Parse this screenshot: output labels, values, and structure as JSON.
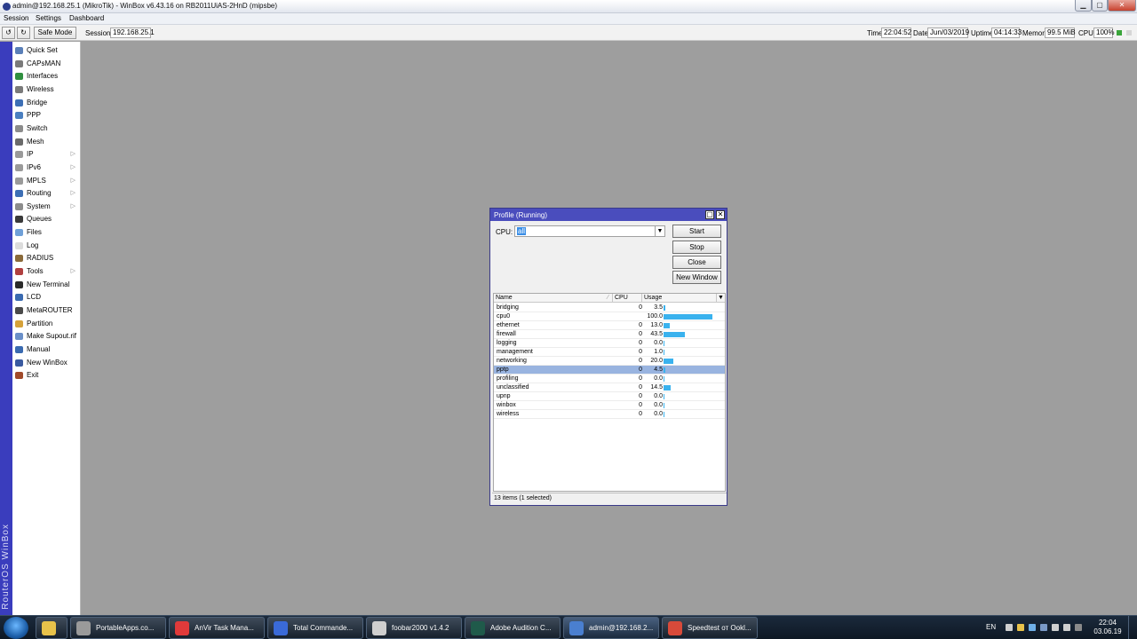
{
  "window": {
    "title": "admin@192.168.25.1 (MikroTik) - WinBox v6.43.16 on RB2011UiAS-2HnD (mipsbe)",
    "controls": {
      "minimize": "▁",
      "maximize": "▢",
      "close": "✕"
    }
  },
  "menu": [
    "Session",
    "Settings",
    "Dashboard"
  ],
  "toolbar": {
    "undo_icon": "↺",
    "redo_icon": "↻",
    "safe_mode": "Safe Mode",
    "session_label": "Session:",
    "session_value": "192.168.25.1",
    "time_label": "Time",
    "time_value": "22:04:52",
    "date_label": "Date",
    "date_value": "Jun/03/2019",
    "uptime_label": "Uptime",
    "uptime_value": "04:14:33",
    "memory_label": "Memory",
    "memory_value": "99.5 MiB",
    "cpu_label": "CPU",
    "cpu_value": "100%",
    "status_colors": [
      "#3aa53a",
      "#d6d6d6"
    ]
  },
  "sidebar": {
    "brand": "RouterOS WinBox",
    "items": [
      {
        "label": "Quick Set",
        "icon": "quickset-icon",
        "color": "#5a7fb8",
        "submenu": false
      },
      {
        "label": "CAPsMAN",
        "icon": "capsman-icon",
        "color": "#7a7a7a",
        "submenu": false
      },
      {
        "label": "Interfaces",
        "icon": "interfaces-icon",
        "color": "#2f8f3f",
        "submenu": false
      },
      {
        "label": "Wireless",
        "icon": "wireless-icon",
        "color": "#7a7a7a",
        "submenu": false
      },
      {
        "label": "Bridge",
        "icon": "bridge-icon",
        "color": "#3d6fb5",
        "submenu": false
      },
      {
        "label": "PPP",
        "icon": "ppp-icon",
        "color": "#4a7fc0",
        "submenu": false
      },
      {
        "label": "Switch",
        "icon": "switch-icon",
        "color": "#8c8c8c",
        "submenu": false
      },
      {
        "label": "Mesh",
        "icon": "mesh-icon",
        "color": "#6a6a6a",
        "submenu": false
      },
      {
        "label": "IP",
        "icon": "ip-icon",
        "color": "#9a9a9a",
        "submenu": true
      },
      {
        "label": "IPv6",
        "icon": "ipv6-icon",
        "color": "#9a9a9a",
        "submenu": true
      },
      {
        "label": "MPLS",
        "icon": "mpls-icon",
        "color": "#9a9a9a",
        "submenu": true
      },
      {
        "label": "Routing",
        "icon": "routing-icon",
        "color": "#3d6fb5",
        "submenu": true
      },
      {
        "label": "System",
        "icon": "system-icon",
        "color": "#8c8c8c",
        "submenu": true
      },
      {
        "label": "Queues",
        "icon": "queues-icon",
        "color": "#3a3a3a",
        "submenu": false
      },
      {
        "label": "Files",
        "icon": "files-icon",
        "color": "#6fa0d8",
        "submenu": false
      },
      {
        "label": "Log",
        "icon": "log-icon",
        "color": "#dcdcdc",
        "submenu": false
      },
      {
        "label": "RADIUS",
        "icon": "radius-icon",
        "color": "#8a6a3a",
        "submenu": false
      },
      {
        "label": "Tools",
        "icon": "tools-icon",
        "color": "#b04040",
        "submenu": true
      },
      {
        "label": "New Terminal",
        "icon": "terminal-icon",
        "color": "#2a2a2a",
        "submenu": false
      },
      {
        "label": "LCD",
        "icon": "lcd-icon",
        "color": "#3a6ab0",
        "submenu": false
      },
      {
        "label": "MetaROUTER",
        "icon": "metarouter-icon",
        "color": "#4a4a4a",
        "submenu": false
      },
      {
        "label": "Partition",
        "icon": "partition-icon",
        "color": "#d6a23a",
        "submenu": false
      },
      {
        "label": "Make Supout.rif",
        "icon": "supout-icon",
        "color": "#6a8fc8",
        "submenu": false
      },
      {
        "label": "Manual",
        "icon": "manual-icon",
        "color": "#3a6ab0",
        "submenu": false
      },
      {
        "label": "New WinBox",
        "icon": "winbox-icon",
        "color": "#3a5aa0",
        "submenu": false
      },
      {
        "label": "Exit",
        "icon": "exit-icon",
        "color": "#a04a2a",
        "submenu": false
      }
    ]
  },
  "profile": {
    "title": "Profile (Running)",
    "max_icon": "▢",
    "close_icon": "✕",
    "cpu_label": "CPU:",
    "cpu_value": "all",
    "dropdown_icon": "▼",
    "buttons": {
      "start": "Start",
      "stop": "Stop",
      "close": "Close",
      "new_window": "New Window"
    },
    "columns": {
      "name": "Name",
      "cpu": "CPU",
      "usage": "Usage"
    },
    "sort_icon": "⁄",
    "menu_icon": "▼",
    "bar_color": "#3ab2ee",
    "rows": [
      {
        "name": "bridging",
        "cpu": "0",
        "usage": "3.5",
        "value": 3.5,
        "selected": false
      },
      {
        "name": "cpu0",
        "cpu": "",
        "usage": "100.0",
        "value": 100.0,
        "selected": false
      },
      {
        "name": "ethernet",
        "cpu": "0",
        "usage": "13.0",
        "value": 13.0,
        "selected": false
      },
      {
        "name": "firewall",
        "cpu": "0",
        "usage": "43.5",
        "value": 43.5,
        "selected": false
      },
      {
        "name": "logging",
        "cpu": "0",
        "usage": "0.0",
        "value": 0.0,
        "selected": false
      },
      {
        "name": "management",
        "cpu": "0",
        "usage": "1.0",
        "value": 1.0,
        "selected": false
      },
      {
        "name": "networking",
        "cpu": "0",
        "usage": "20.0",
        "value": 20.0,
        "selected": false
      },
      {
        "name": "pptp",
        "cpu": "0",
        "usage": "4.5",
        "value": 4.5,
        "selected": true
      },
      {
        "name": "profiling",
        "cpu": "0",
        "usage": "0.0",
        "value": 0.0,
        "selected": false
      },
      {
        "name": "unclassified",
        "cpu": "0",
        "usage": "14.5",
        "value": 14.5,
        "selected": false
      },
      {
        "name": "upnp",
        "cpu": "0",
        "usage": "0.0",
        "value": 0.0,
        "selected": false
      },
      {
        "name": "winbox",
        "cpu": "0",
        "usage": "0.0",
        "value": 0.0,
        "selected": false
      },
      {
        "name": "wireless",
        "cpu": "0",
        "usage": "0.0",
        "value": 0.0,
        "selected": false
      }
    ],
    "status": "13 items (1 selected)"
  },
  "taskbar": {
    "items": [
      {
        "label": "",
        "icon": "explorer-icon",
        "color": "#e8c24a",
        "active": false
      },
      {
        "label": "PortableApps.co...",
        "icon": "portableapps-icon",
        "color": "#9a9a9a",
        "active": false
      },
      {
        "label": "AnVir Task Mana...",
        "icon": "anvir-icon",
        "color": "#e03a3a",
        "active": false
      },
      {
        "label": "Total Commande...",
        "icon": "totalcommander-icon",
        "color": "#3a6ad8",
        "active": false
      },
      {
        "label": "foobar2000 v1.4.2",
        "icon": "foobar-icon",
        "color": "#cfcfcf",
        "active": false
      },
      {
        "label": "Adobe Audition C...",
        "icon": "audition-icon",
        "color": "#1f5a4a",
        "active": false
      },
      {
        "label": "admin@192.168.2...",
        "icon": "winbox-task-icon",
        "color": "#4a7fd0",
        "active": true
      },
      {
        "label": "Speedtest от Ookl...",
        "icon": "chrome-icon",
        "color": "#d84a3a",
        "active": false
      }
    ],
    "tray": {
      "lang": "EN",
      "icons": [
        "#cfcfcf",
        "#e8c24a",
        "#6fb0e8",
        "#7a9ac8",
        "#cfcfcf",
        "#cfcfcf",
        "#8a8a8a"
      ],
      "time": "22:04",
      "date": "03.06.19"
    }
  }
}
